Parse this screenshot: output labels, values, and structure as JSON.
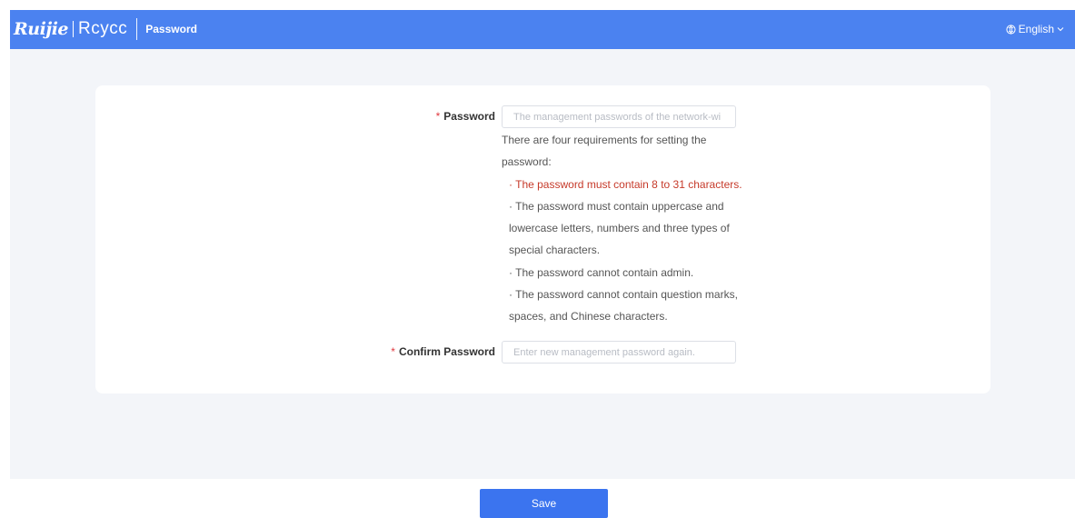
{
  "header": {
    "brand": "Ruijie",
    "sub_brand": "Rcycc",
    "page_title": "Password",
    "language": "English",
    "icons": {
      "language": "globe-icon",
      "dropdown": "chevron-down-icon"
    },
    "background_color": "#4b82f0"
  },
  "form": {
    "password": {
      "required_mark": "*",
      "label": "Password",
      "value": "",
      "placeholder": "The management passwords of the network-wi"
    },
    "requirements": {
      "intro": "There are four requirements for setting the password:",
      "rules": [
        {
          "text": "· The password must contain 8 to 31 characters.",
          "error": true
        },
        {
          "text": "· The password must contain uppercase and lowercase letters, numbers and three types of special characters.",
          "error": false
        },
        {
          "text": "· The password cannot contain admin.",
          "error": false
        },
        {
          "text": "· The password cannot contain question marks, spaces, and Chinese characters.",
          "error": false
        }
      ],
      "error_color": "#c63a2a"
    },
    "confirm_password": {
      "required_mark": "*",
      "label": "Confirm Password",
      "value": "",
      "placeholder": "Enter new management password again."
    }
  },
  "footer": {
    "save_label": "Save",
    "button_color": "#3b74ef"
  }
}
